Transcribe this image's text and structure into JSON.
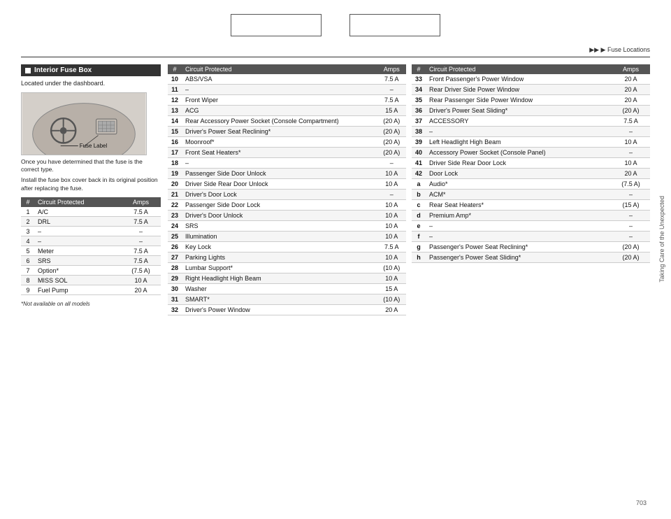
{
  "topBoxes": [
    "box1",
    "box2"
  ],
  "navBar": {
    "text": "▶▶ ▶ Fuse Locations"
  },
  "leftPanel": {
    "sectionTitle": "Interior Fuse Box",
    "description": "Located under the dashboard.",
    "fuseLabel": "Fuse Label",
    "subText1": "Once you have determined that the fuse is the correct type.",
    "subText2": "Install the fuse box cover back in its original position after replacing the fuse.",
    "tableHeader": [
      "Circuit Protected",
      "Amps"
    ],
    "tableRows": [
      {
        "num": "1",
        "circuit": "A/C",
        "amps": "7.5 A"
      },
      {
        "num": "2",
        "circuit": "DRL",
        "amps": "7.5 A"
      },
      {
        "num": "3",
        "circuit": "–",
        "amps": "–"
      },
      {
        "num": "4",
        "circuit": "–",
        "amps": "–"
      },
      {
        "num": "5",
        "circuit": "Meter",
        "amps": "7.5 A"
      },
      {
        "num": "6",
        "circuit": "SRS",
        "amps": "7.5 A"
      },
      {
        "num": "7",
        "circuit": "Option*",
        "amps": "(7.5 A)"
      },
      {
        "num": "8",
        "circuit": "MISS SOL",
        "amps": "10 A"
      },
      {
        "num": "9",
        "circuit": "Fuel Pump",
        "amps": "20 A"
      }
    ],
    "footnote": "*Not available on all models"
  },
  "middleTable": {
    "headers": [
      "Circuit Protected",
      "Amps"
    ],
    "rows": [
      {
        "num": "10",
        "circuit": "ABS/VSA",
        "amps": "7.5 A"
      },
      {
        "num": "11",
        "circuit": "–",
        "amps": "–"
      },
      {
        "num": "12",
        "circuit": "Front Wiper",
        "amps": "7.5 A"
      },
      {
        "num": "13",
        "circuit": "ACG",
        "amps": "15 A"
      },
      {
        "num": "14",
        "circuit": "Rear Accessory Power Socket (Console Compartment)",
        "amps": "(20 A)"
      },
      {
        "num": "15",
        "circuit": "Driver's Power Seat Reclining*",
        "amps": "(20 A)"
      },
      {
        "num": "16",
        "circuit": "Moonroof*",
        "amps": "(20 A)"
      },
      {
        "num": "17",
        "circuit": "Front Seat Heaters*",
        "amps": "(20 A)"
      },
      {
        "num": "18",
        "circuit": "–",
        "amps": "–"
      },
      {
        "num": "19",
        "circuit": "Passenger Side Door Unlock",
        "amps": "10 A"
      },
      {
        "num": "20",
        "circuit": "Driver Side Rear Door Unlock",
        "amps": "10 A"
      },
      {
        "num": "21",
        "circuit": "Driver's Door Lock",
        "amps": "–"
      },
      {
        "num": "22",
        "circuit": "Passenger Side Door Lock",
        "amps": "10 A"
      },
      {
        "num": "23",
        "circuit": "Driver's Door Unlock",
        "amps": "10 A"
      },
      {
        "num": "24",
        "circuit": "SRS",
        "amps": "10 A"
      },
      {
        "num": "25",
        "circuit": "Illumination",
        "amps": "10 A"
      },
      {
        "num": "26",
        "circuit": "Key Lock",
        "amps": "7.5 A"
      },
      {
        "num": "27",
        "circuit": "Parking Lights",
        "amps": "10 A"
      },
      {
        "num": "28",
        "circuit": "Lumbar Support*",
        "amps": "(10 A)"
      },
      {
        "num": "29",
        "circuit": "Right Headlight High Beam",
        "amps": "10 A"
      },
      {
        "num": "30",
        "circuit": "Washer",
        "amps": "15 A"
      },
      {
        "num": "31",
        "circuit": "SMART*",
        "amps": "(10 A)"
      },
      {
        "num": "32",
        "circuit": "Driver's Power Window",
        "amps": "20 A"
      }
    ]
  },
  "rightTable": {
    "headers": [
      "Circuit Protected",
      "Amps"
    ],
    "rows": [
      {
        "num": "33",
        "circuit": "Front Passenger's Power Window",
        "amps": "20 A"
      },
      {
        "num": "34",
        "circuit": "Rear Driver Side Power Window",
        "amps": "20 A"
      },
      {
        "num": "35",
        "circuit": "Rear Passenger Side Power Window",
        "amps": "20 A"
      },
      {
        "num": "36",
        "circuit": "Driver's Power Seat Sliding*",
        "amps": "(20 A)"
      },
      {
        "num": "37",
        "circuit": "ACCESSORY",
        "amps": "7.5 A"
      },
      {
        "num": "38",
        "circuit": "–",
        "amps": "–"
      },
      {
        "num": "39",
        "circuit": "Left Headlight High Beam",
        "amps": "10 A"
      },
      {
        "num": "40",
        "circuit": "Accessory Power Socket (Console Panel)",
        "amps": "–"
      },
      {
        "num": "41",
        "circuit": "Driver Side Rear Door Lock",
        "amps": "10 A"
      },
      {
        "num": "42",
        "circuit": "Door Lock",
        "amps": "20 A"
      },
      {
        "num": "a",
        "circuit": "Audio*",
        "amps": "(7.5 A)"
      },
      {
        "num": "b",
        "circuit": "ACM*",
        "amps": "–"
      },
      {
        "num": "c",
        "circuit": "Rear Seat Heaters*",
        "amps": "(15 A)"
      },
      {
        "num": "d",
        "circuit": "Premium Amp*",
        "amps": "–"
      },
      {
        "num": "e",
        "circuit": "–",
        "amps": "–"
      },
      {
        "num": "f",
        "circuit": "–",
        "amps": "–"
      },
      {
        "num": "g",
        "circuit": "Passenger's Power Seat Reclining*",
        "amps": "(20 A)"
      },
      {
        "num": "h",
        "circuit": "Passenger's Power Seat Sliding*",
        "amps": "(20 A)"
      }
    ]
  },
  "pageNumber": "703",
  "sidebarLabel": "Taking Care of the Unexpected"
}
